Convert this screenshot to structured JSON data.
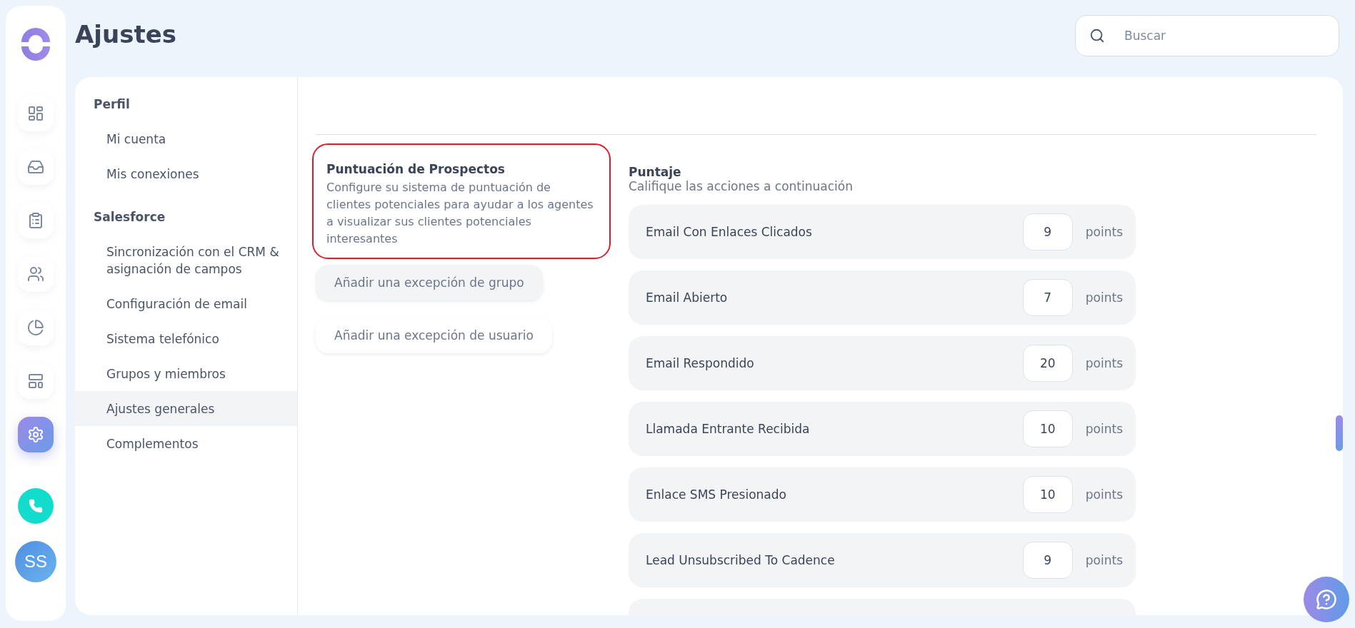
{
  "page_title": "Ajustes",
  "search": {
    "placeholder": "Buscar"
  },
  "rail": {
    "items": [
      {
        "kind": "dashboard",
        "selected": false
      },
      {
        "kind": "inbox",
        "selected": false
      },
      {
        "kind": "clipboard",
        "selected": false
      },
      {
        "kind": "users",
        "selected": false
      },
      {
        "kind": "chart",
        "selected": false
      },
      {
        "kind": "layout",
        "selected": false
      },
      {
        "kind": "settings",
        "selected": true
      }
    ],
    "avatar": "SS"
  },
  "settings_nav": [
    {
      "heading": "Perfil",
      "items": [
        {
          "label": "Mi cuenta",
          "selected": false
        },
        {
          "label": "Mis conexiones",
          "selected": false
        }
      ]
    },
    {
      "heading": "Salesforce",
      "items": [
        {
          "label": "Sincronización con el CRM & asignación de campos",
          "selected": false
        },
        {
          "label": "Configuración de email",
          "selected": false
        },
        {
          "label": "Sistema telefónico",
          "selected": false
        },
        {
          "label": "Grupos y miembros",
          "selected": false
        },
        {
          "label": "Ajustes generales",
          "selected": true
        },
        {
          "label": "Complementos",
          "selected": false
        }
      ]
    }
  ],
  "section": {
    "title": "Puntuación de Prospectos",
    "description": "Configure su sistema de puntuación de clientes potenciales para ayudar a los agentes a visualizar sus clientes potenciales interesantes",
    "highlighted": true,
    "buttons": [
      {
        "label": "Añadir una excepción de grupo",
        "selected": true
      },
      {
        "label": "Añadir una excepción de usuario",
        "selected": false
      }
    ]
  },
  "scoring": {
    "title": "Puntaje",
    "subtitle": "Califique las acciones a continuación",
    "rows": [
      {
        "action": "Email Con Enlaces Clicados",
        "value": "9",
        "unit": "points"
      },
      {
        "action": "Email Abierto",
        "value": "7",
        "unit": "points"
      },
      {
        "action": "Email Respondido",
        "value": "20",
        "unit": "points"
      },
      {
        "action": "Llamada Entrante Recibida",
        "value": "10",
        "unit": "points"
      },
      {
        "action": "Enlace SMS Presionado",
        "value": "10",
        "unit": "points"
      },
      {
        "action": "Lead Unsubscribed To Cadence",
        "value": "9",
        "unit": "points"
      }
    ]
  }
}
